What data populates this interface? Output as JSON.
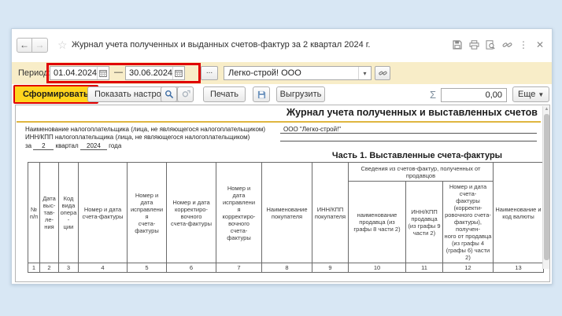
{
  "window": {
    "title": "Журнал учета полученных и выданных счетов-фактур за 2 квартал 2024 г.",
    "nav": {
      "back": "←",
      "forward": "→",
      "favorite": "☆"
    },
    "icons": {
      "more_vertical": "⋮",
      "close": "✕"
    }
  },
  "period_row": {
    "label": "Период:",
    "date_from": "01.04.2024",
    "dash": "—",
    "date_to": "30.06.2024",
    "more_button": "...",
    "organization": "Легко-строй! ООО",
    "dropdown_glyph": "▾"
  },
  "toolbar": {
    "generate": "Сформировать",
    "show_settings": "Показать настройки",
    "print": "Печать",
    "export": "Выгрузить",
    "sigma": "Σ",
    "sum_value": "0,00",
    "more": "Еще",
    "more_caret": "▼"
  },
  "colors": {
    "annotation_red": "#E00000",
    "highlight_yellow": "#FFD51E",
    "period_row_bg": "#F8EDC8",
    "separator_yellow": "#DFB640"
  },
  "report": {
    "title": "Журнал учета полученных и выставленных счетов",
    "taxpayer_name_label": "Наименование налогоплательщика (лица, не являющегося налогоплательщиком)",
    "taxpayer_name_value": "ООО \"Легко-строй!\"",
    "inn_label": "ИНН/КПП налогоплательщика (лица, не являющегося налогоплательщиком)",
    "period_line": {
      "za": "за",
      "quarter": "2",
      "kvartal": "квартал",
      "year": "2024",
      "goda": "года"
    },
    "part1_title": "Часть 1. Выставленные счета-фактуры",
    "group_header": "Сведения из счетов-фактур, полученных от\nпродавцов",
    "columns": [
      {
        "label": "№\nп/п",
        "num": "1"
      },
      {
        "label": "Дата\nвыс-\nтав-\nле-\nния",
        "num": "2"
      },
      {
        "label": "Код\nвида\nопера\n-\nции",
        "num": "3"
      },
      {
        "label": "Номер и дата\nсчета-фактуры",
        "num": "4"
      },
      {
        "label": "Номер и\nдата\nисправлени\nя\nсчета-\nфактуры",
        "num": "5"
      },
      {
        "label": "Номер и дата\nкорректиро-\nвочного\nсчета-фактуры",
        "num": "6"
      },
      {
        "label": "Номер и\nдата\nисправлени\nя\nкорректиро-\nвочного\nсчета-\nфактуры",
        "num": "7"
      },
      {
        "label": "Наименование\nпокупателя",
        "num": "8"
      },
      {
        "label": "ИНН/КПП\nпокупателя",
        "num": "9"
      },
      {
        "label": "наименование\nпродавца (из\nграфы 8 части 2)",
        "num": "10"
      },
      {
        "label": "ИНН/КПП\nпродавца\n(из графы 9\nчасти 2)",
        "num": "11"
      },
      {
        "label": "Номер и дата\nсчета-\nфактуры\n(корректи-\nровочного счета-\nфактуры),\nполучен-\nного от продавца\n(из графы 4\n(графы 6) части\n2)",
        "num": "12"
      },
      {
        "label": "Наименование и\nкод валюты",
        "num": "13"
      }
    ],
    "scroll_up_glyph": "▲"
  }
}
